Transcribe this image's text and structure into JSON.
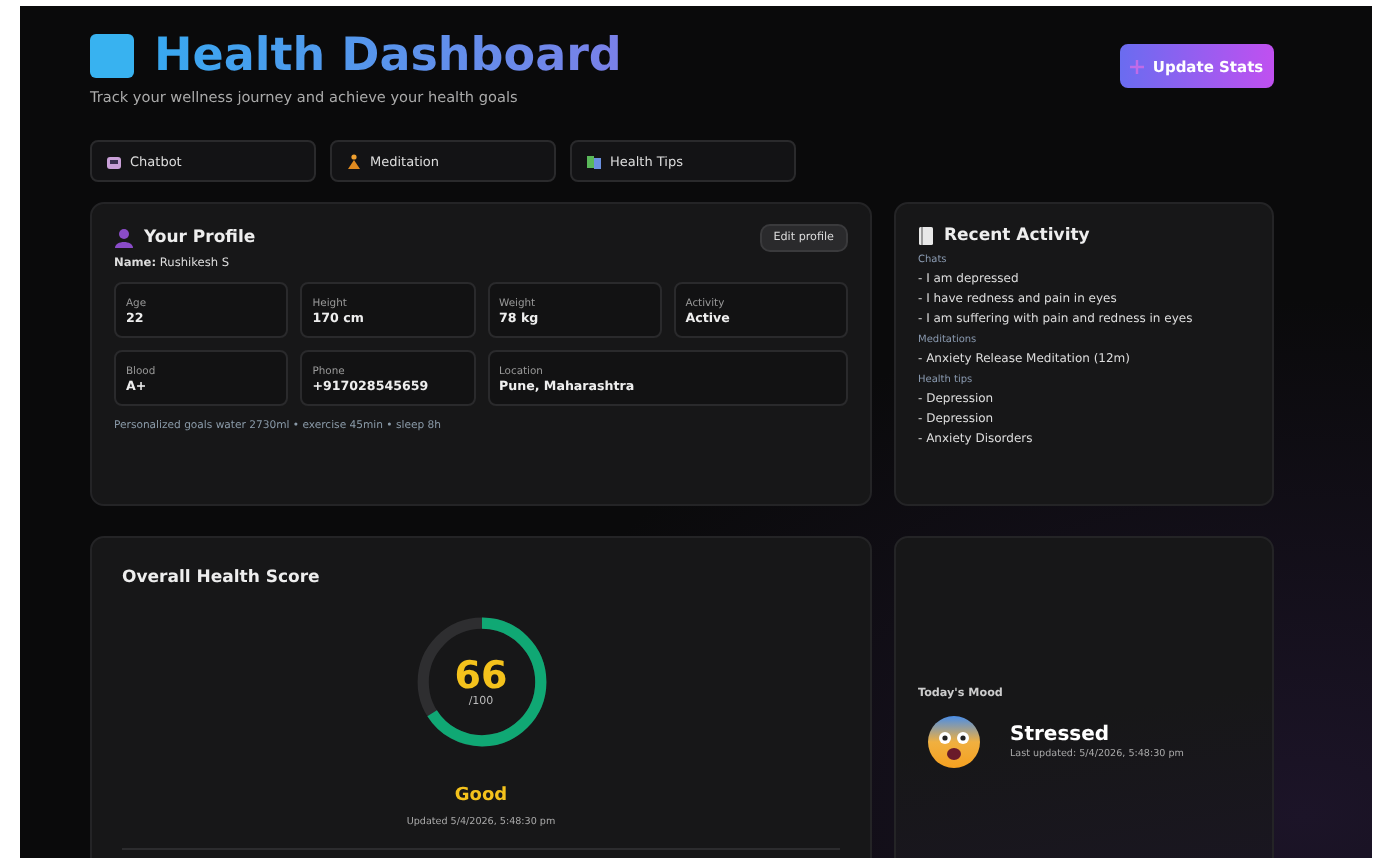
{
  "header": {
    "title": "Health Dashboard",
    "subtitle": "Track your wellness journey and achieve your health goals",
    "action": "Update Stats"
  },
  "nav": [
    {
      "label": "Chatbot",
      "kind": "chatbot"
    },
    {
      "label": "Meditation",
      "kind": "meditation"
    },
    {
      "label": "Health Tips",
      "kind": "tips"
    }
  ],
  "profile": {
    "title": "Your Profile",
    "edit": "Edit profile",
    "name_label": "Name:",
    "name": "Rushikesh S",
    "fields": [
      {
        "label": "Age",
        "value": "22"
      },
      {
        "label": "Height",
        "value": "170 cm"
      },
      {
        "label": "Weight",
        "value": "78 kg"
      },
      {
        "label": "Activity",
        "value": "Active"
      },
      {
        "label": "Blood",
        "value": "A+"
      },
      {
        "label": "Phone",
        "value": "+917028545659"
      },
      {
        "label": "Location",
        "value": "Pune, Maharashtra",
        "wide": true
      }
    ],
    "goals": "Personalized goals water 2730ml • exercise 45min • sleep 8h"
  },
  "recent": {
    "title": "Recent Activity",
    "groups": [
      {
        "heading": "Chats",
        "items": [
          "- I am depressed",
          "- I have redness and pain in eyes",
          "- I am suffering with pain and redness in eyes"
        ]
      },
      {
        "heading": "Meditations",
        "items": [
          "- Anxiety Release Meditation (12m)"
        ]
      },
      {
        "heading": "Health tips",
        "items": [
          "- Depression",
          "- Depression",
          "- Anxiety Disorders"
        ]
      }
    ]
  },
  "score": {
    "title": "Overall Health Score",
    "value": "66",
    "max": "/100",
    "level": 0.66,
    "rating": "Good",
    "updated": "Updated 5/4/2026, 5:48:30 pm"
  },
  "mood": {
    "heading": "Today's Mood",
    "mood": "Stressed",
    "updated": "Last updated: 5/4/2026, 5:48:30 pm"
  }
}
